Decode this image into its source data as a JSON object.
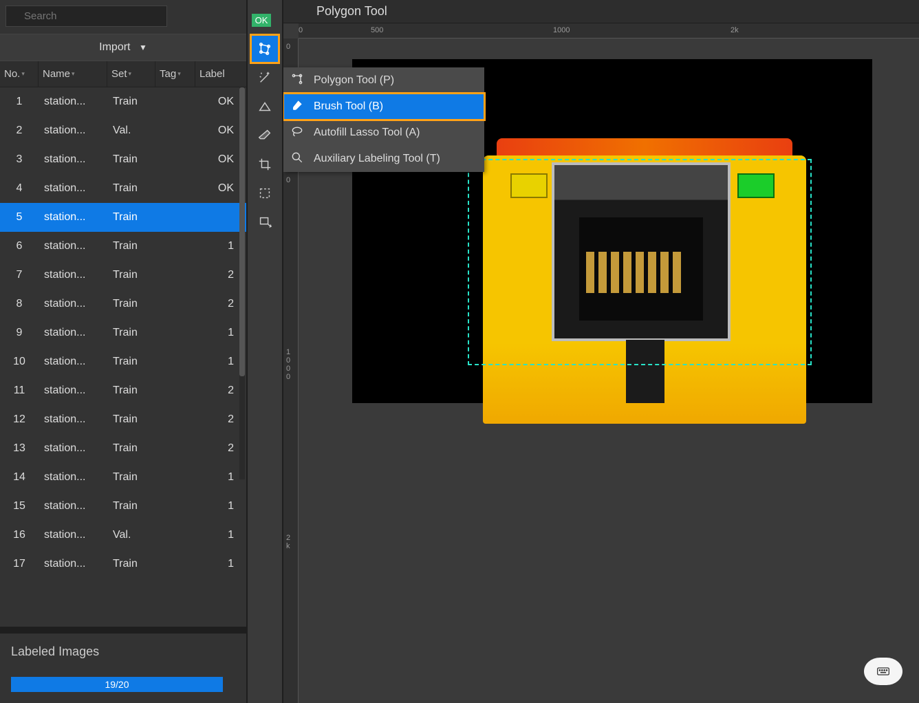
{
  "sidebar": {
    "search_placeholder": "Search",
    "import_label": "Import",
    "columns": {
      "no": "No.",
      "name": "Name",
      "set": "Set",
      "tag": "Tag",
      "label": "Label"
    },
    "rows": [
      {
        "no": "1",
        "name": "station...",
        "set": "Train",
        "tag": "",
        "label": "OK"
      },
      {
        "no": "2",
        "name": "station...",
        "set": "Val.",
        "tag": "",
        "label": "OK"
      },
      {
        "no": "3",
        "name": "station...",
        "set": "Train",
        "tag": "",
        "label": "OK"
      },
      {
        "no": "4",
        "name": "station...",
        "set": "Train",
        "tag": "",
        "label": "OK"
      },
      {
        "no": "5",
        "name": "station...",
        "set": "Train",
        "tag": "",
        "label": ""
      },
      {
        "no": "6",
        "name": "station...",
        "set": "Train",
        "tag": "",
        "label": "1"
      },
      {
        "no": "7",
        "name": "station...",
        "set": "Train",
        "tag": "",
        "label": "2"
      },
      {
        "no": "8",
        "name": "station...",
        "set": "Train",
        "tag": "",
        "label": "2"
      },
      {
        "no": "9",
        "name": "station...",
        "set": "Train",
        "tag": "",
        "label": "1"
      },
      {
        "no": "10",
        "name": "station...",
        "set": "Train",
        "tag": "",
        "label": "1"
      },
      {
        "no": "11",
        "name": "station...",
        "set": "Train",
        "tag": "",
        "label": "2"
      },
      {
        "no": "12",
        "name": "station...",
        "set": "Train",
        "tag": "",
        "label": "2"
      },
      {
        "no": "13",
        "name": "station...",
        "set": "Train",
        "tag": "",
        "label": "2"
      },
      {
        "no": "14",
        "name": "station...",
        "set": "Train",
        "tag": "",
        "label": "1"
      },
      {
        "no": "15",
        "name": "station...",
        "set": "Train",
        "tag": "",
        "label": "1"
      },
      {
        "no": "16",
        "name": "station...",
        "set": "Val.",
        "tag": "",
        "label": "1"
      },
      {
        "no": "17",
        "name": "station...",
        "set": "Train",
        "tag": "",
        "label": "1"
      }
    ],
    "selected_row_index": 4,
    "progress": {
      "title": "Labeled Images",
      "text": "19/20"
    }
  },
  "toolbar": {
    "ok_chip": "OK",
    "tools": [
      "polygon-tool",
      "magic-wand-tool",
      "shape-tool",
      "eraser-tool",
      "crop-tool",
      "marquee-tool",
      "transform-tool"
    ],
    "active_tool_index": 0
  },
  "tool_menu": {
    "items": [
      {
        "label": "Polygon Tool (P)",
        "icon": "polygon-node-icon"
      },
      {
        "label": "Brush Tool (B)",
        "icon": "brush-icon"
      },
      {
        "label": "Autofill Lasso Tool (A)",
        "icon": "lasso-icon"
      },
      {
        "label": "Auxiliary Labeling Tool (T)",
        "icon": "aux-label-icon"
      }
    ],
    "selected_index": 1
  },
  "canvas": {
    "title": "Polygon Tool",
    "ruler_top": {
      "ticks": [
        {
          "pos": 0,
          "label": "0"
        },
        {
          "pos": 105,
          "label": "500"
        },
        {
          "pos": 370,
          "label": "1000"
        },
        {
          "pos": 628,
          "label": "2k"
        }
      ]
    },
    "ruler_left": {
      "ticks": [
        {
          "pos": 6,
          "label": "0"
        },
        {
          "pos": 200,
          "label": "0"
        },
        {
          "pos": 450,
          "label": "1\n0\n0\n0"
        },
        {
          "pos": 720,
          "label": "2\nk"
        }
      ]
    }
  },
  "colors": {
    "accent": "#0f7ae5",
    "highlight_border": "#ffa117",
    "ok_green": "#32b36a",
    "selection": "#28e3c9"
  }
}
